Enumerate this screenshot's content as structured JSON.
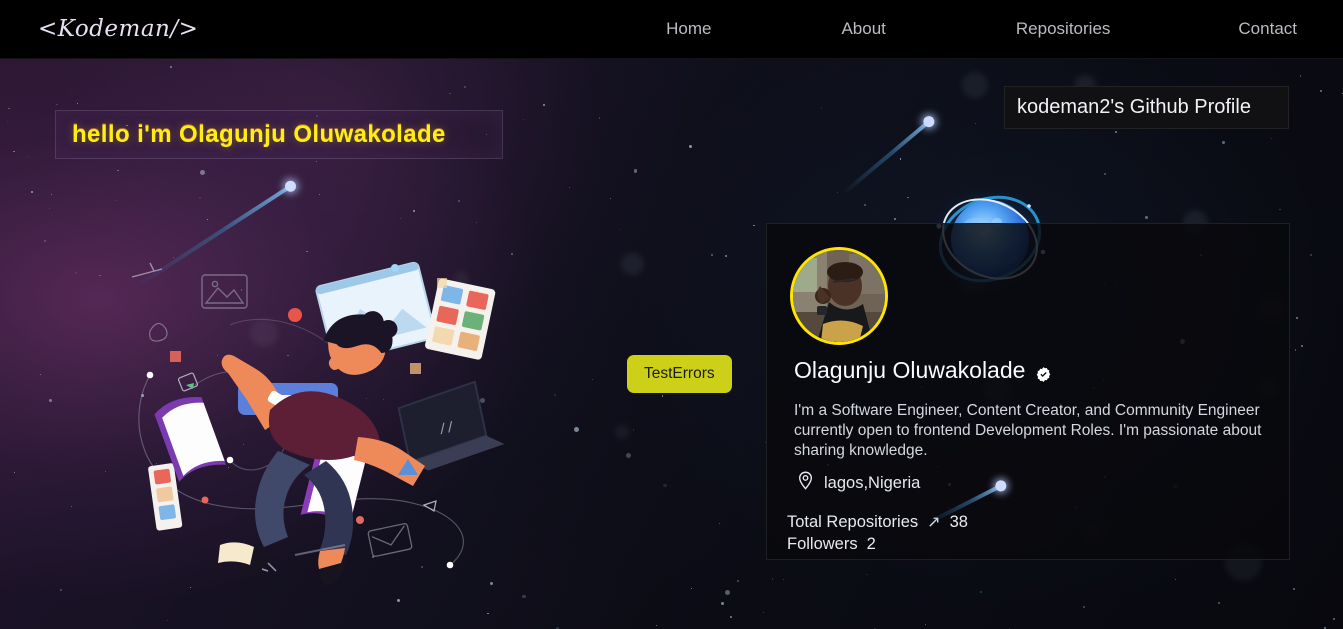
{
  "navbar": {
    "logo": "<Kodeman/>",
    "links": [
      {
        "label": "Home"
      },
      {
        "label": "About"
      },
      {
        "label": "Repositories"
      },
      {
        "label": "Contact"
      }
    ]
  },
  "hero": {
    "title": "hello i'm Olagunju Oluwakolade",
    "illustration_name": "floating-developer-illustration",
    "test_button_label": "TestErrors"
  },
  "github": {
    "header_title": "kodeman2's Github Profile",
    "orb_name": "glowing-blue-orb",
    "profile": {
      "avatar_name": "user-avatar-photo",
      "name": "Olagunju Oluwakolade",
      "verified_icon": "verified-badge-icon",
      "bio": "I'm a Software Engineer, Content Creator, and Community Engineer currently open to frontend Development Roles. I'm passionate about sharing knowledge.",
      "location_icon": "map-pin-icon",
      "location": "lagos,Nigeria",
      "stats": {
        "repositories_label": "Total Repositories",
        "repositories_arrow": "↗",
        "repositories_value": "38",
        "followers_label": "Followers",
        "followers_value": "2"
      }
    }
  },
  "colors": {
    "accent_yellow": "#ffef10",
    "button_olive": "#cdd019",
    "avatar_ring": "#ffe500",
    "nav_bg": "#000000",
    "orb_blue": "#3d97f0"
  }
}
